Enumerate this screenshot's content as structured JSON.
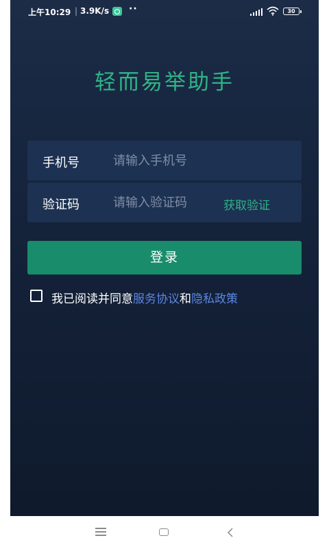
{
  "status_bar": {
    "time": "上午10:29",
    "separator": "|",
    "net_speed": "3.9K/s",
    "more": "··",
    "battery": "30"
  },
  "app": {
    "title": "轻而易举助手"
  },
  "form": {
    "phone_label": "手机号",
    "phone_placeholder": "请输入手机号",
    "code_label": "验证码",
    "code_placeholder": "请输入验证码",
    "get_code_label": "获取验证"
  },
  "login_button": "登录",
  "agreement": {
    "prefix": "我已阅读并同意",
    "service_link": "服务协议",
    "conjunction": "和",
    "privacy_link": "隐私政策",
    "checked": false
  },
  "colors": {
    "accent_green": "#2fb487",
    "button_green": "#198c6c",
    "link_blue": "#5b86e3",
    "background_dark": "#14223a"
  },
  "icons": {
    "status_app": "shield-app-icon",
    "signal": "signal-icon",
    "wifi": "wifi-icon",
    "battery": "battery-icon",
    "nav_menu": "menu-icon",
    "nav_home": "home-icon",
    "nav_back": "back-icon"
  }
}
